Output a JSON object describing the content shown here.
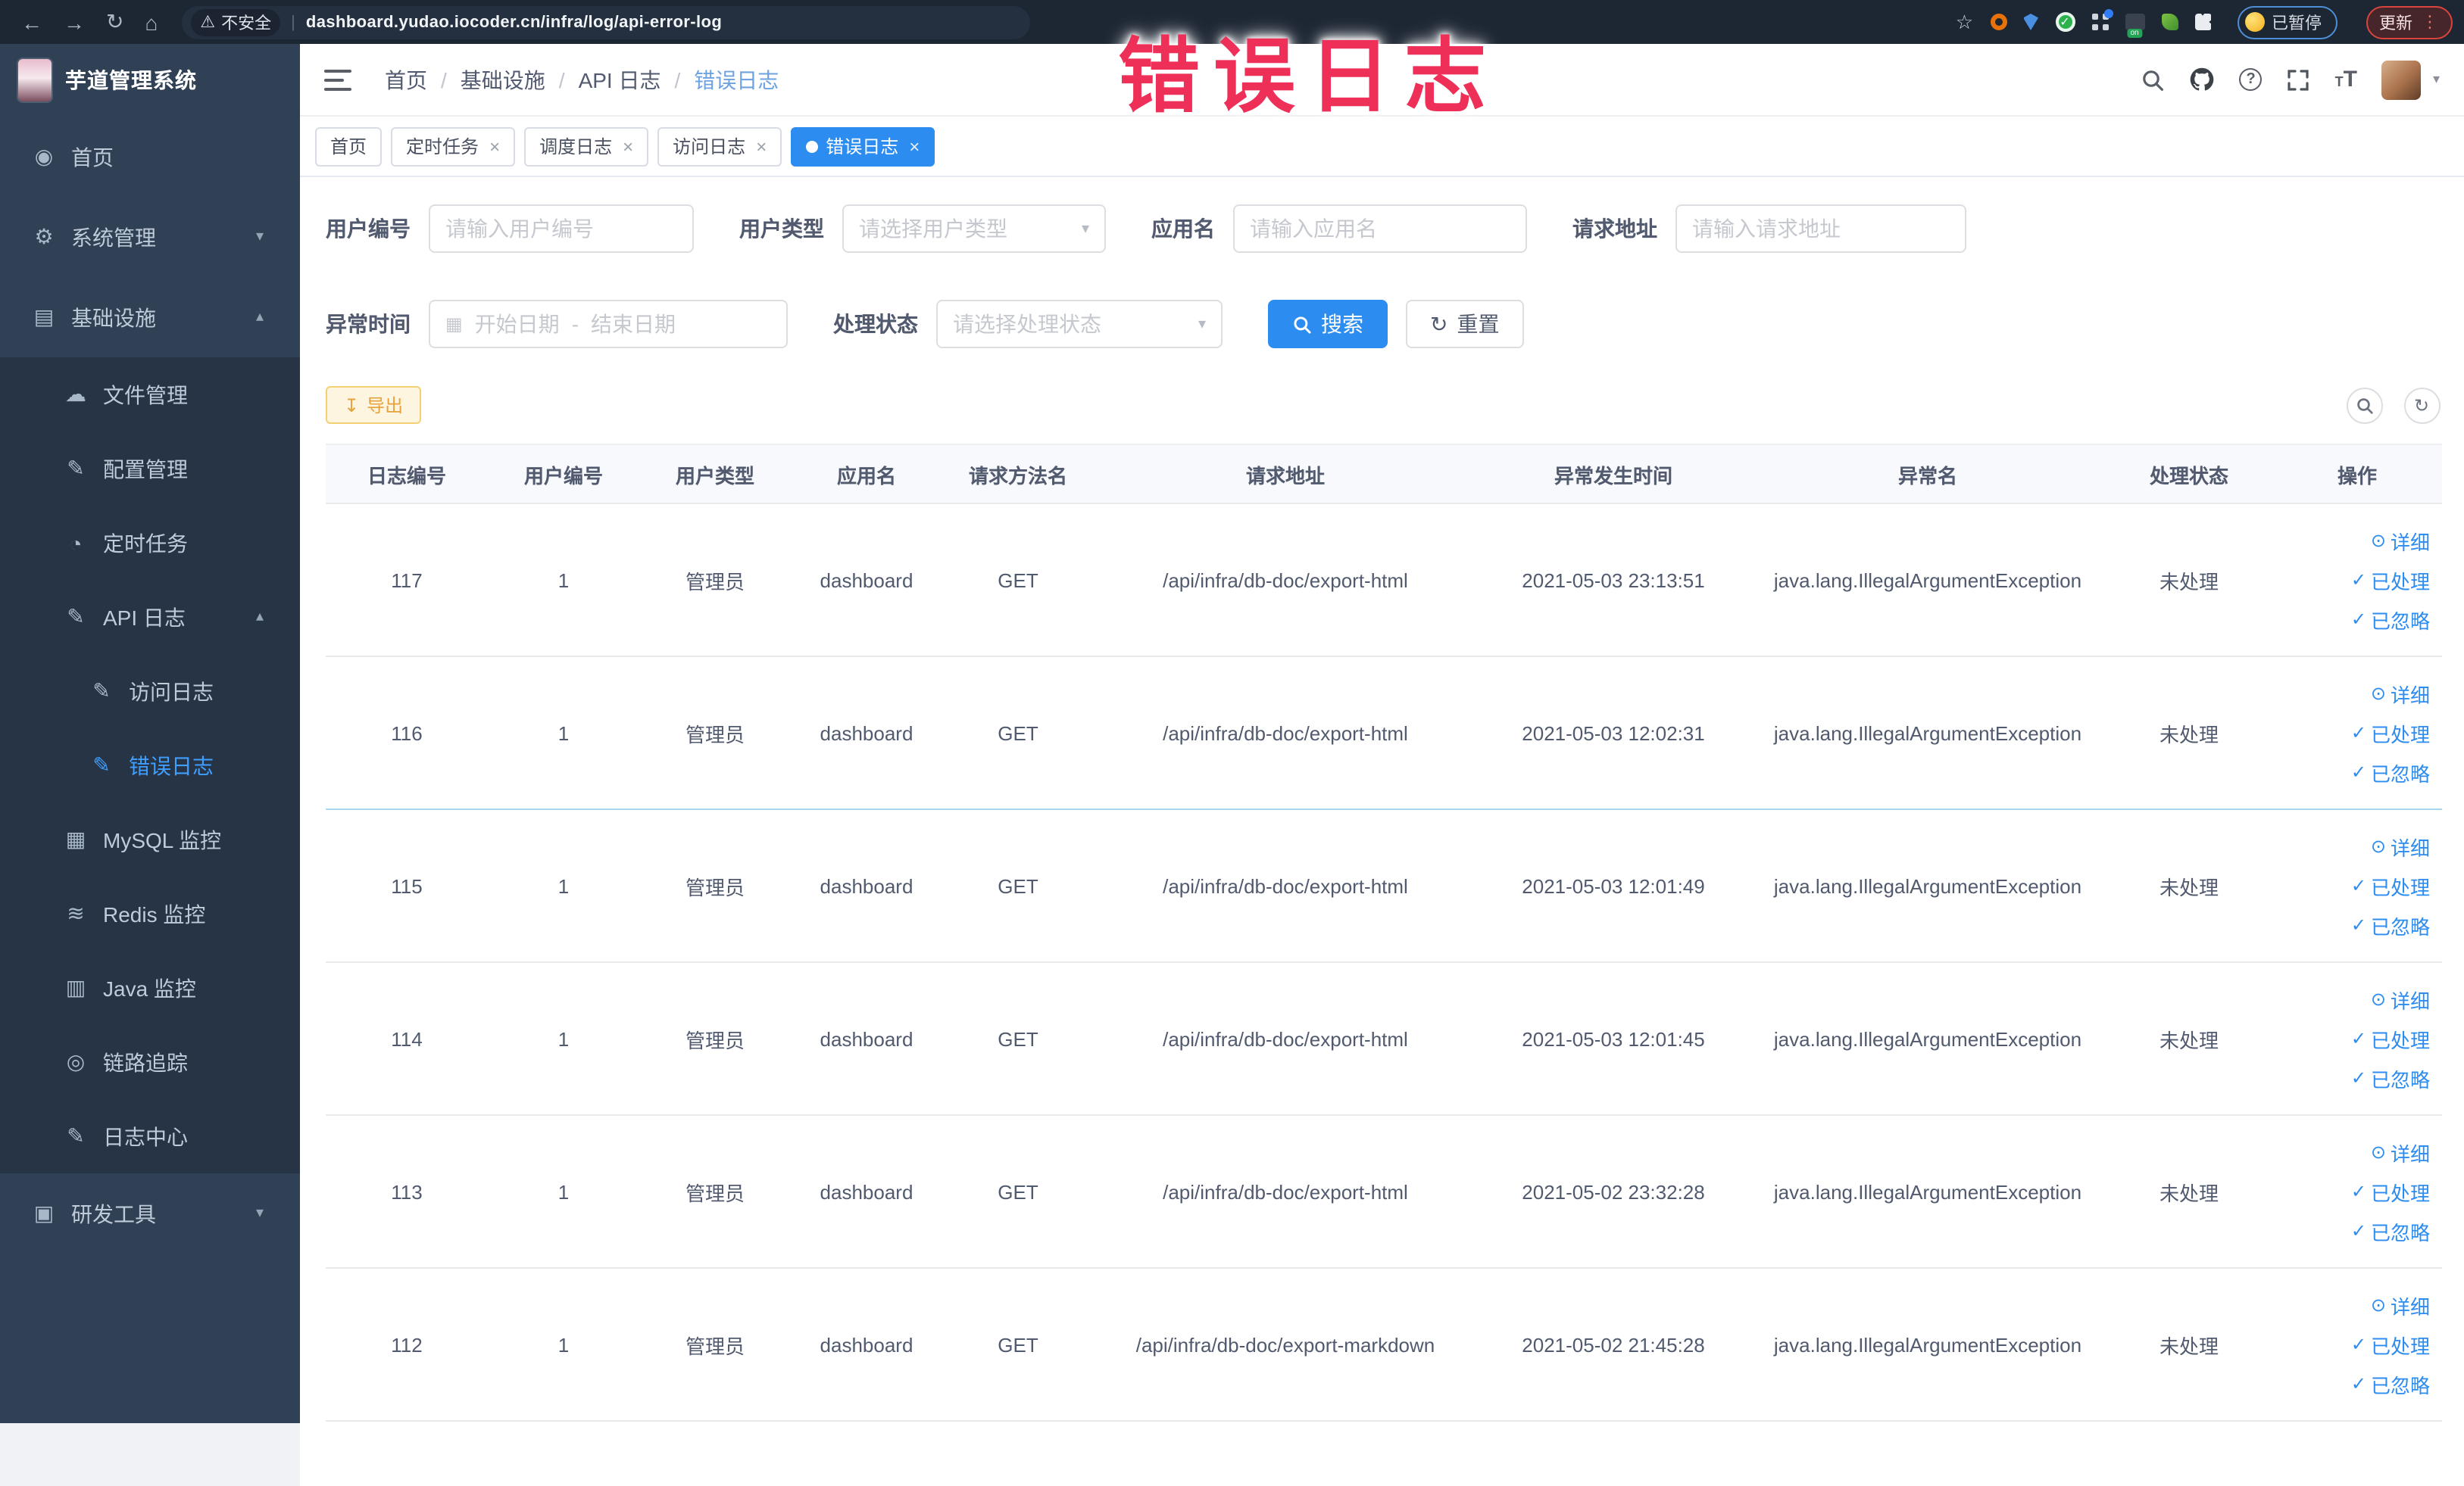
{
  "overlay": {
    "title": "错误日志"
  },
  "browser": {
    "security_label": "不安全",
    "url": "dashboard.yudao.iocoder.cn/infra/log/api-error-log",
    "on_badge": "on",
    "paused_badge": "已暂停",
    "update_button": "更新",
    "icons": {
      "back": "←",
      "forward": "→",
      "reload": "↻",
      "home": "⌂",
      "warning": "⚠",
      "star": "☆",
      "kebab": "⋮",
      "check": "✓"
    }
  },
  "logo": {
    "title": "芋道管理系统"
  },
  "breadcrumb": {
    "separator": "/",
    "items": [
      "首页",
      "基础设施",
      "API 日志",
      "错误日志"
    ]
  },
  "tabs_meta": {
    "close_glyph": "×"
  },
  "tabs": [
    {
      "label": "首页",
      "closable": false,
      "active": false
    },
    {
      "label": "定时任务",
      "closable": true,
      "active": false
    },
    {
      "label": "调度日志",
      "closable": true,
      "active": false
    },
    {
      "label": "访问日志",
      "closable": true,
      "active": false
    },
    {
      "label": "错误日志",
      "closable": true,
      "active": true
    }
  ],
  "sidebar": {
    "items": [
      {
        "level": 1,
        "icon": "dashboard-icon",
        "glyph": "◉",
        "label": "首页",
        "arrow": "",
        "active": false
      },
      {
        "level": 1,
        "icon": "gear-icon",
        "glyph": "⚙",
        "label": "系统管理",
        "arrow": "▾",
        "active": false
      },
      {
        "level": 1,
        "icon": "infrastructure-monitor-icon",
        "glyph": "▤",
        "label": "基础设施",
        "arrow": "▴",
        "active": false
      },
      {
        "level": 2,
        "icon": "file-cloud-icon",
        "glyph": "☁",
        "label": "文件管理",
        "arrow": "",
        "active": false
      },
      {
        "level": 2,
        "icon": "config-edit-icon",
        "glyph": "✎",
        "label": "配置管理",
        "arrow": "",
        "active": false
      },
      {
        "level": 2,
        "icon": "timer-icon",
        "glyph": "◔",
        "label": "定时任务",
        "arrow": "",
        "active": false
      },
      {
        "level": 2,
        "icon": "api-log-icon",
        "glyph": "✎",
        "label": "API 日志",
        "arrow": "▴",
        "active": false
      },
      {
        "level": 3,
        "icon": "access-log-icon",
        "glyph": "✎",
        "label": "访问日志",
        "arrow": "",
        "active": false
      },
      {
        "level": 3,
        "icon": "error-log-icon",
        "glyph": "✎",
        "label": "错误日志",
        "arrow": "",
        "active": true
      },
      {
        "level": 2,
        "icon": "mysql-monitor-icon",
        "glyph": "▦",
        "label": "MySQL 监控",
        "arrow": "",
        "active": false
      },
      {
        "level": 2,
        "icon": "redis-monitor-icon",
        "glyph": "≋",
        "label": "Redis 监控",
        "arrow": "",
        "active": false
      },
      {
        "level": 2,
        "icon": "java-monitor-icon",
        "glyph": "▥",
        "label": "Java 监控",
        "arrow": "",
        "active": false
      },
      {
        "level": 2,
        "icon": "trace-eye-icon",
        "glyph": "◎",
        "label": "链路追踪",
        "arrow": "",
        "active": false
      },
      {
        "level": 2,
        "icon": "log-center-icon",
        "glyph": "✎",
        "label": "日志中心",
        "arrow": "",
        "active": false
      },
      {
        "level": 1,
        "icon": "dev-tools-icon",
        "glyph": "▣",
        "label": "研发工具",
        "arrow": "▾",
        "active": false
      }
    ]
  },
  "header_icons": {
    "question": "?",
    "font_large": "T",
    "font_small": "T",
    "caret": "▾"
  },
  "filters": {
    "user_id": {
      "label": "用户编号",
      "placeholder": "请输入用户编号"
    },
    "user_type": {
      "label": "用户类型",
      "placeholder": "请选择用户类型"
    },
    "app_name": {
      "label": "应用名",
      "placeholder": "请输入应用名"
    },
    "request_url": {
      "label": "请求地址",
      "placeholder": "请输入请求地址"
    },
    "exception_time": {
      "label": "异常时间",
      "start_placeholder": "开始日期",
      "separator": "-",
      "end_placeholder": "结束日期",
      "calendar_glyph": "▦"
    },
    "process_status": {
      "label": "处理状态",
      "placeholder": "请选择处理状态"
    },
    "search_button": "搜索",
    "reset_button": "重置",
    "reset_glyph": "↻",
    "select_caret": "▾"
  },
  "toolbar": {
    "export_button": "导出",
    "export_glyph": "↧",
    "refresh_glyph": "↻"
  },
  "table": {
    "columns": [
      "日志编号",
      "用户编号",
      "用户类型",
      "应用名",
      "请求方法名",
      "请求地址",
      "异常发生时间",
      "异常名",
      "处理状态",
      "操作"
    ],
    "actions": {
      "detail": {
        "label": "详细",
        "glyph": "⊙"
      },
      "processed": {
        "label": "已处理",
        "glyph": "✓"
      },
      "ignored": {
        "label": "已忽略",
        "glyph": "✓"
      }
    },
    "rows": [
      {
        "id": "117",
        "user_id": "1",
        "user_type": "管理员",
        "app": "dashboard",
        "method": "GET",
        "path": "/api/infra/db-doc/export-html",
        "time": "2021-05-03 23:13:51",
        "exception": "java.lang.IllegalArgumentException",
        "status": "未处理"
      },
      {
        "id": "116",
        "user_id": "1",
        "user_type": "管理员",
        "app": "dashboard",
        "method": "GET",
        "path": "/api/infra/db-doc/export-html",
        "time": "2021-05-03 12:02:31",
        "exception": "java.lang.IllegalArgumentException",
        "status": "未处理"
      },
      {
        "id": "115",
        "user_id": "1",
        "user_type": "管理员",
        "app": "dashboard",
        "method": "GET",
        "path": "/api/infra/db-doc/export-html",
        "time": "2021-05-03 12:01:49",
        "exception": "java.lang.IllegalArgumentException",
        "status": "未处理"
      },
      {
        "id": "114",
        "user_id": "1",
        "user_type": "管理员",
        "app": "dashboard",
        "method": "GET",
        "path": "/api/infra/db-doc/export-html",
        "time": "2021-05-03 12:01:45",
        "exception": "java.lang.IllegalArgumentException",
        "status": "未处理"
      },
      {
        "id": "113",
        "user_id": "1",
        "user_type": "管理员",
        "app": "dashboard",
        "method": "GET",
        "path": "/api/infra/db-doc/export-html",
        "time": "2021-05-02 23:32:28",
        "exception": "java.lang.IllegalArgumentException",
        "status": "未处理"
      },
      {
        "id": "112",
        "user_id": "1",
        "user_type": "管理员",
        "app": "dashboard",
        "method": "GET",
        "path": "/api/infra/db-doc/export-markdown",
        "time": "2021-05-02 21:45:28",
        "exception": "java.lang.IllegalArgumentException",
        "status": "未处理"
      }
    ]
  },
  "colors": {
    "accent_blue": "#2d8cf0",
    "sidebar_active": "#409eff",
    "warning_orange": "#e6a23c",
    "annotation_pink": "#ee2f57"
  }
}
